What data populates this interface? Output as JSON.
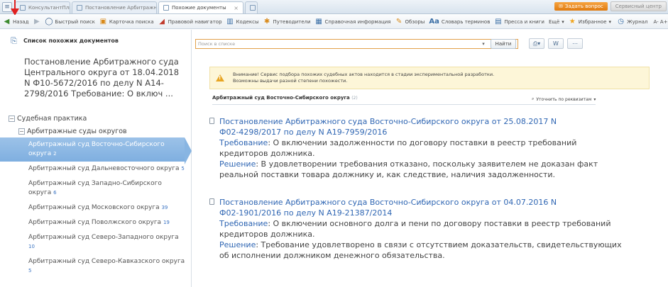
{
  "tabs": [
    {
      "label": "КонсультантПлюс",
      "active": false
    },
    {
      "label": "Постановление Арбитражного суд...",
      "active": false
    },
    {
      "label": "Похожие документы",
      "active": true
    },
    {
      "label": "",
      "active": false
    }
  ],
  "top_right": {
    "ask_label": "Задать вопрос",
    "service_label": "Сервисный центр"
  },
  "toolbar": {
    "back": "Назад",
    "quick_search": "Быстрый поиск",
    "card_search": "Карточка поиска",
    "legal_navigator": "Правовой навигатор",
    "codes": "Кодексы",
    "news": "Путеводители",
    "reference": "Справочная информация",
    "reviews": "Обзоры",
    "dictionary_glyph": "Aa",
    "dictionary": "Словарь терминов",
    "press": "Пресса и книги",
    "more": "Ещё",
    "favorites": "Избранное",
    "history": "Журнал",
    "font": "A- A+"
  },
  "left_panel": {
    "header": "Список похожих документов",
    "doc_reference": "Постановление Арбитражного суда Центрального округа от 18.04.2018 N Ф10-5672/2016 по делу N А14-2798/2016 Требование: О включ ...",
    "tree_root": "Судебная практика",
    "tree_group": "Арбитражные суды округов",
    "courts": [
      {
        "name": "Арбитражный суд Восточно-Сибирского округа",
        "count": "2",
        "selected": true
      },
      {
        "name": "Арбитражный суд Дальневосточного округа",
        "count": "5",
        "selected": false
      },
      {
        "name": "Арбитражный суд Западно-Сибирского округа",
        "count": "6",
        "selected": false
      },
      {
        "name": "Арбитражный суд Московского округа",
        "count": "39",
        "selected": false
      },
      {
        "name": "Арбитражный суд Поволжского округа",
        "count": "19",
        "selected": false
      },
      {
        "name": "Арбитражный суд Северо-Западного округа",
        "count": "10",
        "selected": false
      },
      {
        "name": "Арбитражный суд Северо-Кавказского округа",
        "count": "5",
        "selected": false
      }
    ]
  },
  "search": {
    "placeholder": "Поиск в списке",
    "find_label": "Найти"
  },
  "warning": {
    "line1": "Внимание! Сервис подбора похожих судебных актов находится в стадии экспериментальной разработки.",
    "line2": "Возможны выдачи разной степени похожести."
  },
  "group": {
    "title": "Арбитражный суд Восточно-Сибирского округа",
    "count": "(2)",
    "refine": "Уточнить по реквизитам"
  },
  "results": [
    {
      "title_line1": "Постановление Арбитражного суда Восточно-Сибирского округа от 25.08.2017 N",
      "title_line2": "Ф02-4298/2017 по делу N А19-7959/2016",
      "req_label": "Требование",
      "req_line1": ": О включении задолженности по договору поставки в реестр требований",
      "req_line2": "кредиторов должника.",
      "dec_label": "Решение",
      "dec_line1": ": В удовлетворении требования отказано, поскольку заявителем не доказан факт",
      "dec_line2": "реальной поставки товара должнику и, как следствие, наличия задолженности."
    },
    {
      "title_line1": "Постановление Арбитражного суда Восточно-Сибирского округа от 04.07.2016 N",
      "title_line2": "Ф02-1901/2016 по делу N А19-21387/2014",
      "req_label": "Требование",
      "req_line1": ": О включении основного долга и пени по договору поставки в реестр требований",
      "req_line2": "кредиторов должника.",
      "dec_label": "Решение",
      "dec_line1": ": Требование удовлетворено в связи с отсутствием доказательств, свидетельствующих",
      "dec_line2": "об исполнении должником денежного обязательства."
    }
  ],
  "colors": {
    "link_blue": "#2f66b3",
    "selected_bg": "#8fb8e4",
    "warning_bg": "#fdf6d8",
    "annotation_red": "#e02020"
  }
}
